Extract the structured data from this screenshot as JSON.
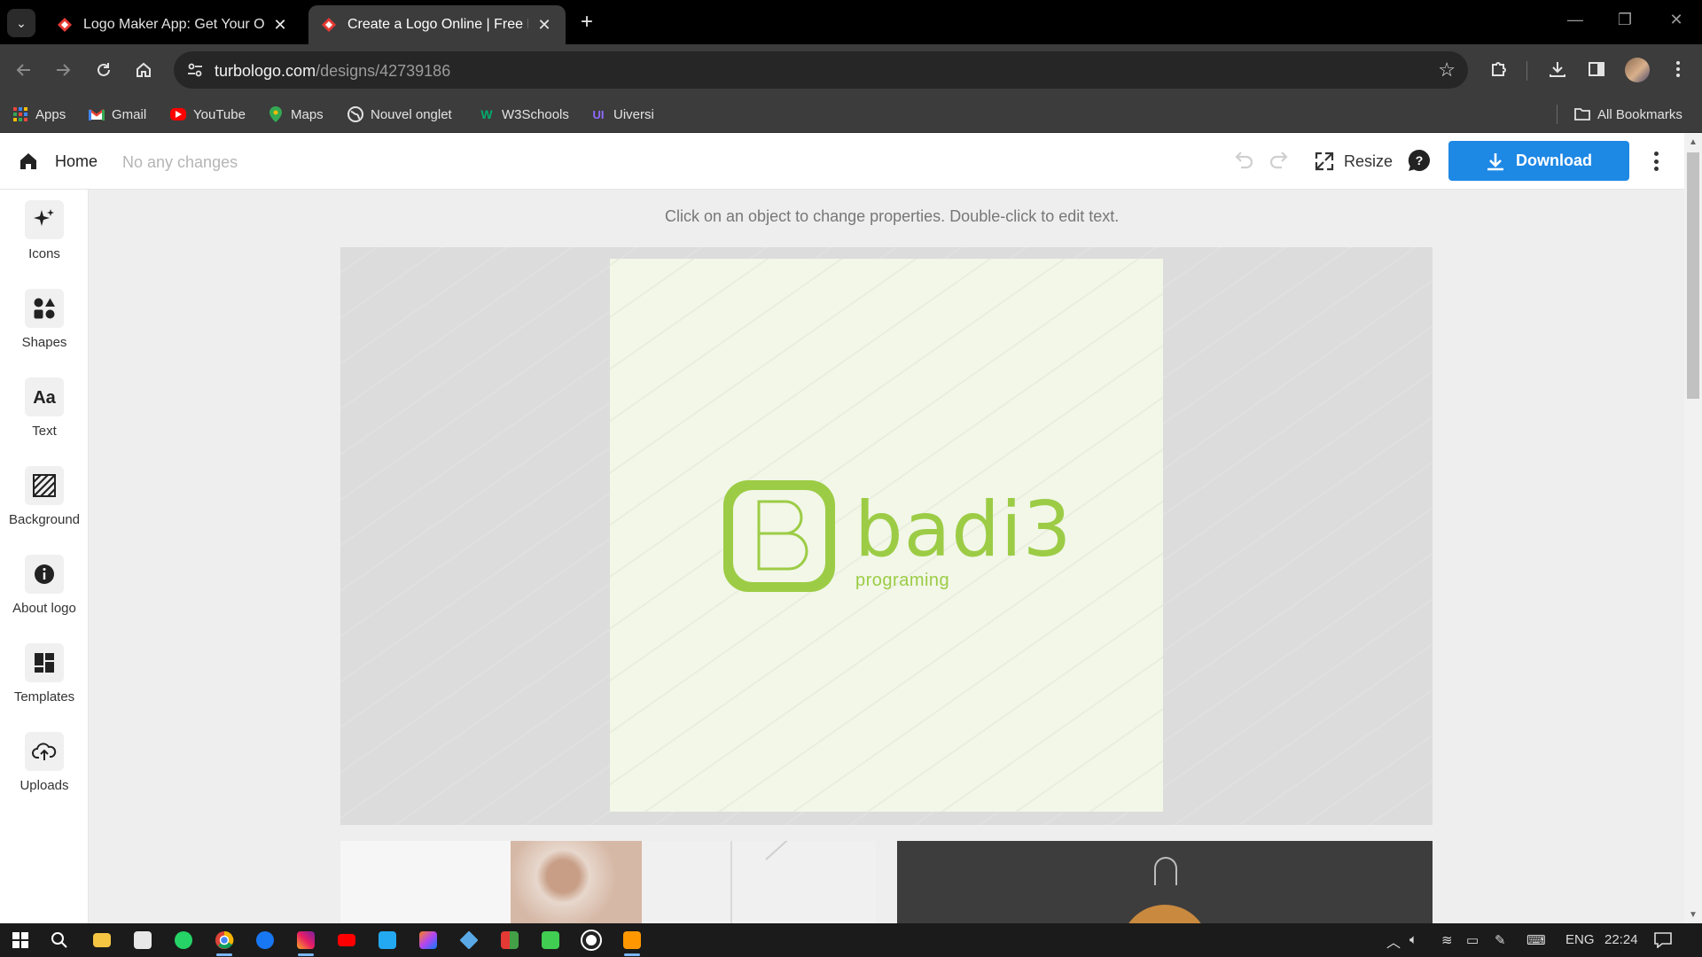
{
  "browser": {
    "tabs": [
      {
        "title": "Logo Maker App: Get Your Own",
        "active": false
      },
      {
        "title": "Create a Logo Online | Free Log",
        "active": true
      }
    ],
    "url_host": "turbologo.com",
    "url_path": "/designs/42739186",
    "bookmarks": [
      "Apps",
      "Gmail",
      "YouTube",
      "Maps",
      "Nouvel onglet",
      "W3Schools",
      "Uiversi"
    ],
    "all_bookmarks": "All Bookmarks"
  },
  "header": {
    "home_label": "Home",
    "status": "No any changes",
    "resize_label": "Resize",
    "download_label": "Download"
  },
  "sidebar": {
    "items": [
      {
        "label": "Icons",
        "icon": "sparkle-icon"
      },
      {
        "label": "Shapes",
        "icon": "shapes-icon"
      },
      {
        "label": "Text",
        "icon": "text-icon"
      },
      {
        "label": "Background",
        "icon": "background-icon"
      },
      {
        "label": "About logo",
        "icon": "info-icon"
      },
      {
        "label": "Templates",
        "icon": "templates-icon"
      },
      {
        "label": "Uploads",
        "icon": "upload-cloud-icon"
      }
    ]
  },
  "workspace": {
    "hint": "Click on an object to change properties. Double-click to edit text.",
    "logo": {
      "name": "badi3",
      "tagline": "programing",
      "color": "#9ccc45",
      "canvas_bg": "#f2f7e8"
    }
  },
  "taskbar": {
    "language": "ENG",
    "time": "22:24"
  },
  "colors": {
    "accent": "#1e88e5",
    "chrome_dark": "#3c3c3c"
  }
}
